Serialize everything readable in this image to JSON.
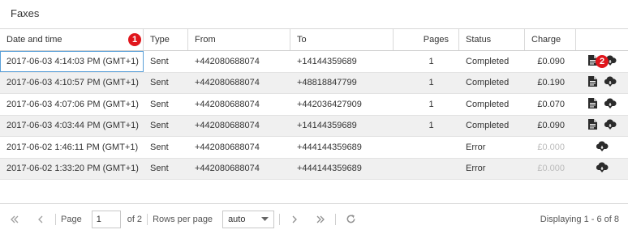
{
  "panel": {
    "title": "Faxes"
  },
  "columns": {
    "date": "Date and time",
    "type": "Type",
    "from": "From",
    "to": "To",
    "pages": "Pages",
    "status": "Status",
    "charge": "Charge"
  },
  "badges": {
    "one": "1",
    "two": "2"
  },
  "rows": [
    {
      "date": "2017-06-03 4:14:03 PM (GMT+1)",
      "type": "Sent",
      "from": "+442080688074",
      "to": "+14144359689",
      "pages": "1",
      "status": "Completed",
      "charge": "£0.090",
      "has_document": true
    },
    {
      "date": "2017-06-03 4:10:57 PM (GMT+1)",
      "type": "Sent",
      "from": "+442080688074",
      "to": "+48818847799",
      "pages": "1",
      "status": "Completed",
      "charge": "£0.190",
      "has_document": true
    },
    {
      "date": "2017-06-03 4:07:06 PM (GMT+1)",
      "type": "Sent",
      "from": "+442080688074",
      "to": "+442036427909",
      "pages": "1",
      "status": "Completed",
      "charge": "£0.070",
      "has_document": true
    },
    {
      "date": "2017-06-03 4:03:44 PM (GMT+1)",
      "type": "Sent",
      "from": "+442080688074",
      "to": "+14144359689",
      "pages": "1",
      "status": "Completed",
      "charge": "£0.090",
      "has_document": true
    },
    {
      "date": "2017-06-02 1:46:11 PM (GMT+1)",
      "type": "Sent",
      "from": "+442080688074",
      "to": "+444144359689",
      "pages": "",
      "status": "Error",
      "charge": "£0.000",
      "has_document": false
    },
    {
      "date": "2017-06-02 1:33:20 PM (GMT+1)",
      "type": "Sent",
      "from": "+442080688074",
      "to": "+444144359689",
      "pages": "",
      "status": "Error",
      "charge": "£0.000",
      "has_document": false
    }
  ],
  "pager": {
    "page_label": "Page",
    "page_value": "1",
    "of_label": "of 2",
    "rows_label": "Rows per page",
    "rows_value": "auto",
    "displaying": "Displaying 1 - 6 of 8"
  },
  "colors": {
    "accent_badge": "#e0161c",
    "selected_outline": "#5aa0d8",
    "alt_row": "#f0f0f0"
  },
  "icons": [
    "document-icon",
    "cloud-download-icon",
    "first-page-icon",
    "prev-page-icon",
    "next-page-icon",
    "last-page-icon",
    "refresh-icon",
    "chevron-down-icon"
  ]
}
